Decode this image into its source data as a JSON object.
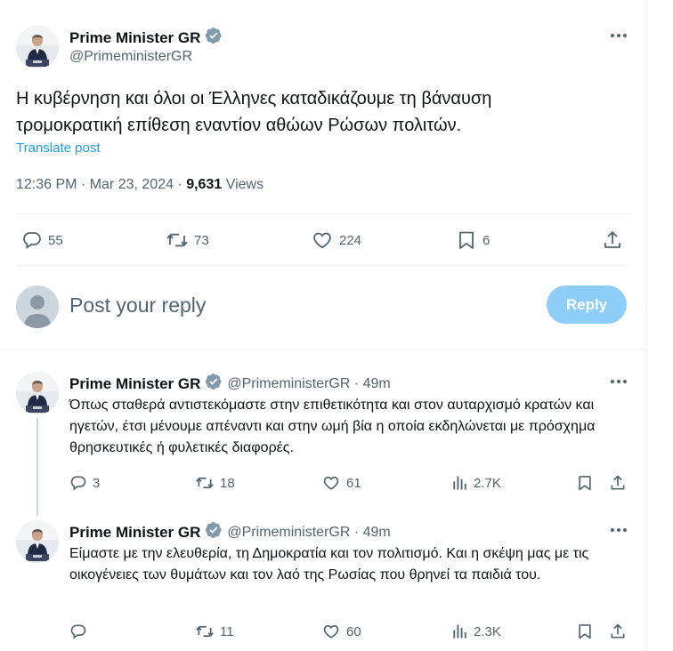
{
  "main_post": {
    "author_name": "Prime Minister GR",
    "author_handle": "@PrimeministerGR",
    "text_line1": "Η κυβέρνηση και όλοι οι Έλληνες καταδικάζουμε τη βάναυση",
    "text_line2": "τρομοκρατική επίθεση εναντίον αθώων Ρώσων πολιτών.",
    "translate_label": "Translate post",
    "timestamp": "12:36 PM · Mar 23, 2024 · ",
    "views_count": "9,631",
    "views_label": " Views",
    "replies": "55",
    "reposts": "73",
    "likes": "224",
    "bookmarks": "6"
  },
  "compose": {
    "placeholder": "Post your reply",
    "button_label": "Reply"
  },
  "replies": [
    {
      "author_name": "Prime Minister GR",
      "author_handle": "@PrimeministerGR · 49m",
      "text": "Όπως σταθερά αντιστεκόμαστε στην επιθετικότητα και στον αυταρχισμό κρατών και ηγετών, έτσι μένουμε απέναντι και στην ωμή βία η οποία εκδηλώνεται με πρόσχημα θρησκευτικές ή φυλετικές διαφορές.",
      "replies": "3",
      "reposts": "18",
      "likes": "61",
      "views": "2.7K"
    },
    {
      "author_name": "Prime Minister GR",
      "author_handle": "@PrimeministerGR · 49m",
      "text": "Είμαστε με την ελευθερία, τη Δημοκρατία και τον πολιτισμό. Και η σκέψη μας με τις οικογένειες των θυμάτων και τον λαό της Ρωσίας που θρηνεί τα παιδιά του.",
      "replies": "",
      "reposts": "11",
      "likes": "60",
      "views": "2.3K"
    }
  ],
  "colors": {
    "accent": "#1d9bf0",
    "reply_button": "#8ecdf8",
    "muted": "#536471",
    "divider": "#eff3f4"
  },
  "icons": [
    "more-icon",
    "verified-badge-icon",
    "reply-icon",
    "repost-icon",
    "like-icon",
    "bookmark-icon",
    "share-icon",
    "views-icon",
    "default-avatar-icon"
  ]
}
